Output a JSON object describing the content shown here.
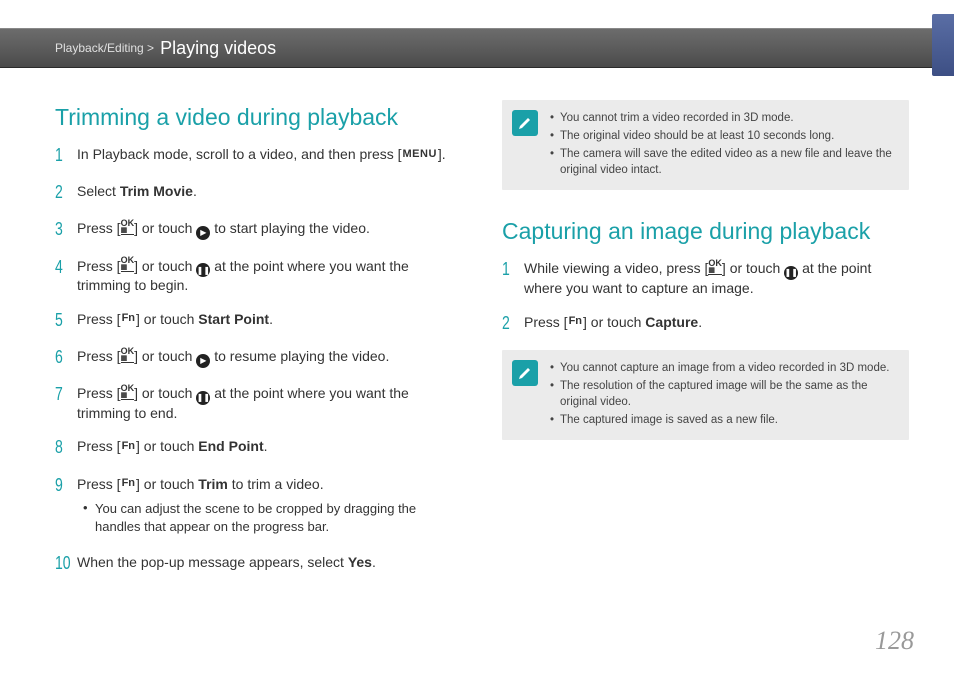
{
  "header": {
    "breadcrumb": "Playback/Editing >",
    "title": "Playing videos"
  },
  "page_number": "128",
  "left": {
    "heading": "Trimming a video during playback",
    "steps": [
      {
        "n": "1",
        "pre": "In Playback mode, scroll to a video, and then press [",
        "icon": "MENU",
        "post": "]."
      },
      {
        "n": "2",
        "pre": "Select ",
        "bold": "Trim Movie",
        "post": "."
      },
      {
        "n": "3",
        "pre": "Press [",
        "ok": true,
        "mid": "] or touch ",
        "circ": "▶",
        "post": " to start playing the video."
      },
      {
        "n": "4",
        "pre": "Press [",
        "ok": true,
        "mid": "] or touch ",
        "circ": "❚❚",
        "post": " at the point where you want the trimming to begin."
      },
      {
        "n": "5",
        "pre": "Press [",
        "fn": true,
        "mid": "] or touch ",
        "bold": "Start Point",
        "post": "."
      },
      {
        "n": "6",
        "pre": "Press [",
        "ok": true,
        "mid": "] or touch ",
        "circ": "▶",
        "post": " to resume playing the video."
      },
      {
        "n": "7",
        "pre": "Press [",
        "ok": true,
        "mid": "] or touch ",
        "circ": "❚❚",
        "post": " at the point where you want the trimming to end."
      },
      {
        "n": "8",
        "pre": "Press [",
        "fn": true,
        "mid": "] or touch ",
        "bold": "End Point",
        "post": "."
      },
      {
        "n": "9",
        "pre": "Press [",
        "fn": true,
        "mid": "] or touch ",
        "bold": "Trim",
        "post": " to trim a video.",
        "sub": [
          "You can adjust the scene to be cropped by dragging the handles that appear on the progress bar."
        ]
      },
      {
        "n": "10",
        "pre": "When the pop-up message appears, select ",
        "bold": "Yes",
        "post": "."
      }
    ]
  },
  "right": {
    "note1": [
      "You cannot trim a video recorded in 3D mode.",
      "The original video should be at least 10 seconds long.",
      "The camera will save the edited video as a new file and leave the original video intact."
    ],
    "heading": "Capturing an image during playback",
    "steps": [
      {
        "n": "1",
        "pre": "While viewing a video, press [",
        "ok": true,
        "mid": "] or touch ",
        "circ": "❚❚",
        "post": " at the point where you want to capture an image."
      },
      {
        "n": "2",
        "pre": "Press [",
        "fn": true,
        "mid": "] or touch ",
        "bold": "Capture",
        "post": "."
      }
    ],
    "note2": [
      "You cannot capture an image from a video recorded in 3D mode.",
      "The resolution of the captured image will be the same as the original video.",
      "The captured image is saved as a new file."
    ]
  }
}
